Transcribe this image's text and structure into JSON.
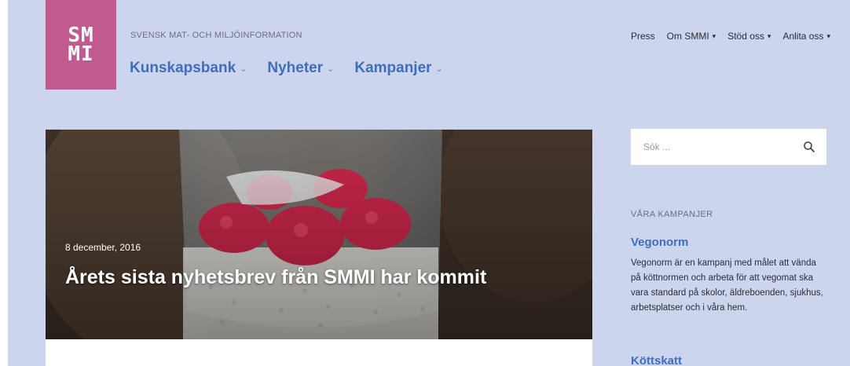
{
  "logo": {
    "text": "SM\nMI"
  },
  "header": {
    "tagline": "SVENSK MAT- OCH MILJÖINFORMATION",
    "main_nav": [
      {
        "label": "Kunskapsbank"
      },
      {
        "label": "Nyheter"
      },
      {
        "label": "Kampanjer"
      }
    ],
    "top_nav": [
      {
        "label": "Press",
        "dropdown": false
      },
      {
        "label": "Om SMMI",
        "dropdown": true
      },
      {
        "label": "Stöd oss",
        "dropdown": true
      },
      {
        "label": "Anlita oss",
        "dropdown": true
      }
    ]
  },
  "hero": {
    "date": "8 december, 2016",
    "title": "Årets sista nyhetsbrev från SMMI har kommit"
  },
  "sidebar": {
    "search_placeholder": "Sök ...",
    "section_heading": "VÅRA KAMPANJER",
    "campaigns": [
      {
        "title": "Vegonorm",
        "description": "Vegonorm är en kampanj med målet att vända på köttnormen och arbeta för att vegomat ska vara standard på skolor, äldreboenden, sjukhus, arbetsplatser och i våra hem."
      },
      {
        "title": "Köttskatt"
      }
    ]
  },
  "colors": {
    "background": "#cdd5ee",
    "logo": "#c15a8f",
    "link": "#3e6fb7"
  },
  "icons": {
    "search": "search-icon",
    "chevron": "chevron-down-icon"
  }
}
